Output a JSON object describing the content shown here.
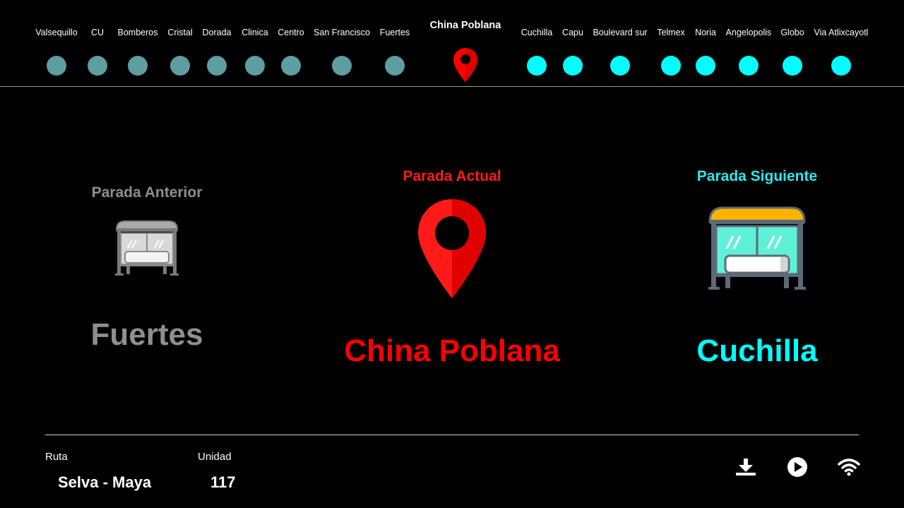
{
  "route_stops": {
    "passed": [
      "Valsequillo",
      "CU",
      "Bomberos",
      "Cristal",
      "Dorada",
      "Clinica",
      "Centro",
      "San Francisco",
      "Fuertes"
    ],
    "current": "China Poblana",
    "upcoming": [
      "Cuchilla",
      "Capu",
      "Boulevard sur",
      "Telmex",
      "Noria",
      "Angelopolis",
      "Globo",
      "Via Atlixcayotl"
    ]
  },
  "panels": {
    "previous": {
      "heading": "Parada Anterior",
      "stop_name": "Fuertes",
      "icon": "bus-stop-icon"
    },
    "current": {
      "heading": "Parada Actual",
      "stop_name": "China Poblana",
      "icon": "location-pin-icon"
    },
    "next": {
      "heading": "Parada Siguiente",
      "stop_name": "Cuchilla",
      "icon": "bus-stop-icon"
    }
  },
  "footer": {
    "route_label": "Ruta",
    "route_value": "Selva - Maya",
    "unit_label": "Unidad",
    "unit_value": "117",
    "controls": [
      "download-icon",
      "play-icon",
      "wifi-icon"
    ]
  },
  "colors": {
    "passed_dot": "#5f9ea0",
    "upcoming_dot": "#00ffff",
    "current": "#ff0000",
    "previous_text": "#8f8f8f",
    "next_text": "#00ffff",
    "background": "#000000"
  }
}
